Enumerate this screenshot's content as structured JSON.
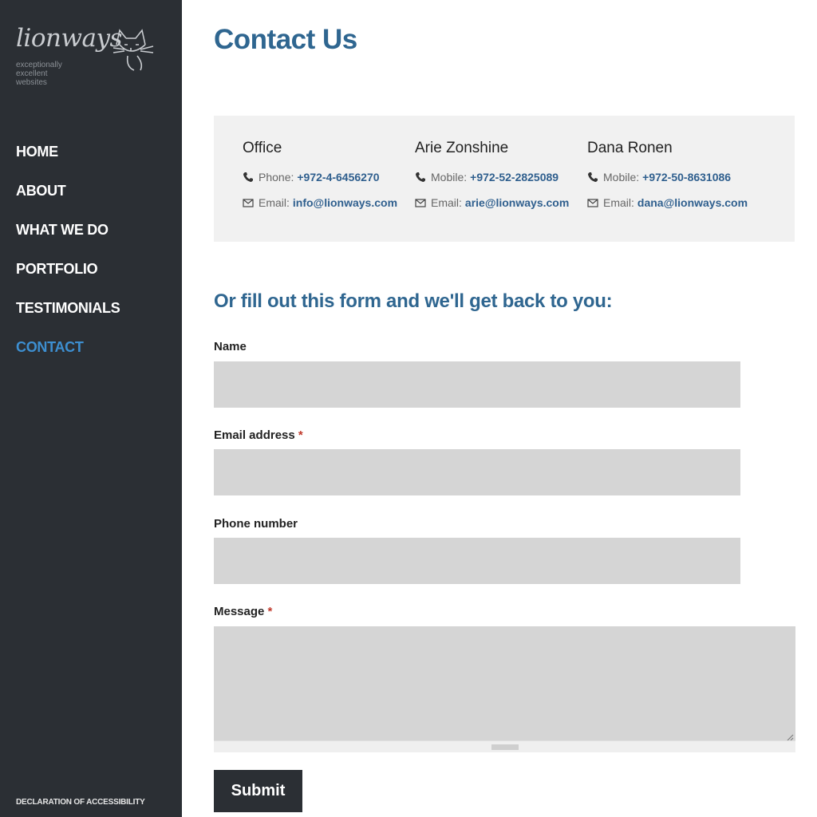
{
  "brand": {
    "name": "lionways",
    "tagline_lines": [
      "exceptionally",
      "excellent",
      "websites"
    ]
  },
  "nav": {
    "items": [
      {
        "label": "HOME"
      },
      {
        "label": "ABOUT"
      },
      {
        "label": "WHAT WE DO"
      },
      {
        "label": "PORTFOLIO"
      },
      {
        "label": "TESTIMONIALS"
      },
      {
        "label": "CONTACT",
        "active": true
      }
    ]
  },
  "footer": {
    "accessibility_label": "DECLARATION OF ACCESSIBILITY"
  },
  "page": {
    "title": "Contact Us"
  },
  "contacts": [
    {
      "name": "Office",
      "phone_label": "Phone:",
      "phone": "+972-4-6456270",
      "email_label": "Email:",
      "email": "info@lionways.com"
    },
    {
      "name": "Arie Zonshine",
      "phone_label": "Mobile:",
      "phone": "+972-52-2825089",
      "email_label": "Email:",
      "email": "arie@lionways.com"
    },
    {
      "name": "Dana Ronen",
      "phone_label": "Mobile:",
      "phone": "+972-50-8631086",
      "email_label": "Email:",
      "email": "dana@lionways.com"
    }
  ],
  "form": {
    "heading": "Or fill out this form and we'll get back to you:",
    "name_label": "Name",
    "email_label": "Email address",
    "phone_label": "Phone number",
    "message_label": "Message",
    "required_mark": "*",
    "name_value": "",
    "email_value": "",
    "phone_value": "",
    "message_value": "",
    "submit_label": "Submit"
  },
  "colors": {
    "sidebar_bg": "#2b2f34",
    "accent": "#2f6690",
    "active_nav": "#3d8fd1",
    "input_bg": "#d5d5d5",
    "required": "#c0392b"
  },
  "icons": {
    "phone": "phone-icon",
    "email": "envelope-icon",
    "logo": "cat-logo-icon"
  }
}
